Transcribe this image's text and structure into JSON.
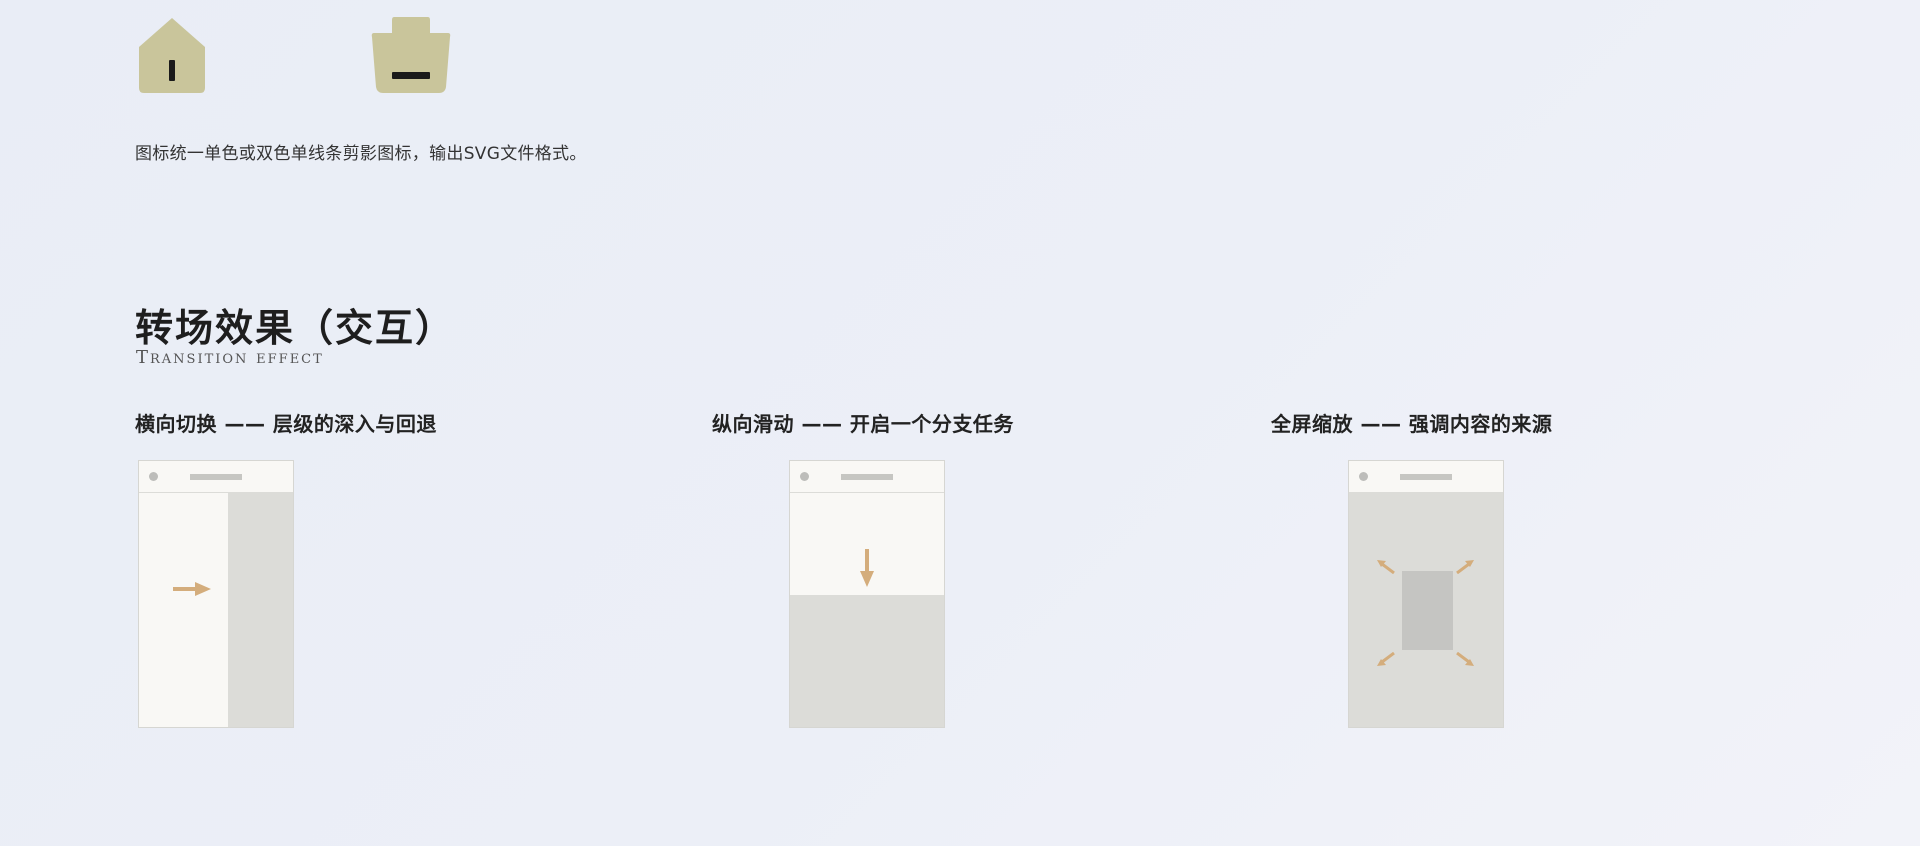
{
  "icons": {
    "home_icon": "home-icon",
    "bag_icon": "bag-icon",
    "icon_color": "#c9c59b"
  },
  "description": "图标统一单色或双色单线条剪影图标，输出SVG文件格式。",
  "section": {
    "title": "转场效果（交互）",
    "subtitle": "Transition effect"
  },
  "transitions": [
    {
      "title": "横向切换 —— 层级的深入与回退"
    },
    {
      "title": "纵向滑动 —— 开启一个分支任务"
    },
    {
      "title": "全屏缩放 —— 强调内容的来源"
    }
  ],
  "colors": {
    "arrow": "#d4ad7c",
    "panel_gray": "#dcdcd8",
    "panel_light": "#f9f8f5"
  }
}
